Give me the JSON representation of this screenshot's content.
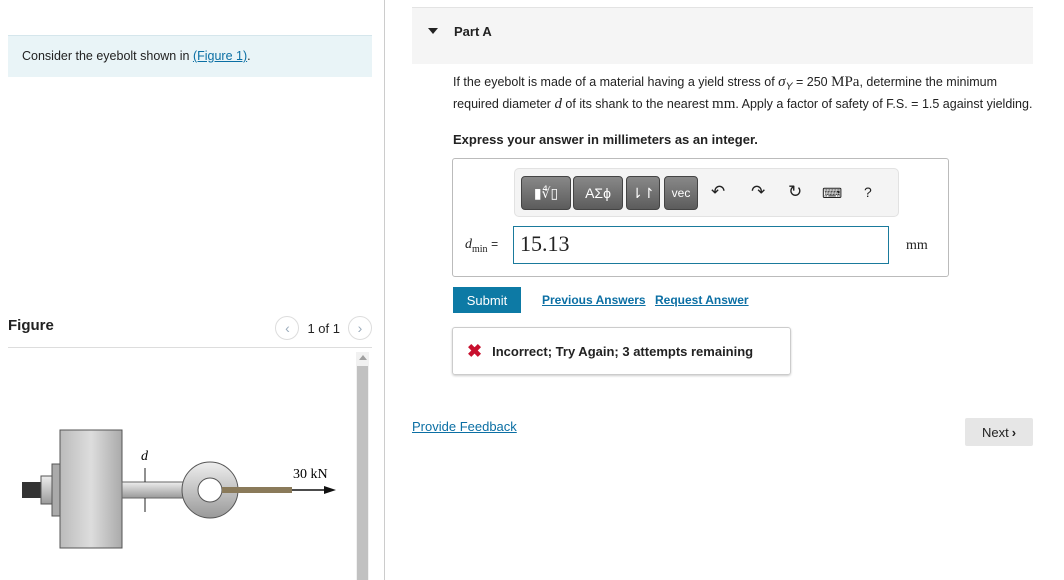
{
  "intro": {
    "text": "Consider the eyebolt shown in ",
    "link": "(Figure 1)",
    "suffix": "."
  },
  "figure": {
    "title": "Figure",
    "pager": "1 of 1",
    "label_d": "d",
    "label_force": "30 kN"
  },
  "part": {
    "title": "Part A"
  },
  "question": {
    "t1": "If the eyebolt is made of a material having a yield stress of ",
    "sigma": "σ",
    "sub": "Y",
    "t2": " = 250 ",
    "mpa": "MPa",
    "t3": ", determine the minimum required diameter ",
    "d": "d",
    "t4": " of its shank to the nearest ",
    "mm": "mm",
    "t5": ". Apply a factor of safety of F.S. = 1.5 against yielding."
  },
  "instruction": "Express your answer in millimeters as an integer.",
  "toolbar": {
    "greek": "ΑΣϕ",
    "arrows": "⇂↾",
    "vec": "vec",
    "help": "?"
  },
  "answer": {
    "var": "d",
    "sub": "min",
    "eq": "=",
    "value": "15.13",
    "unit": "mm"
  },
  "buttons": {
    "submit": "Submit",
    "previous": "Previous Answers",
    "request": "Request Answer",
    "feedback": "Provide Feedback",
    "next": "Next"
  },
  "feedback": {
    "icon": "✖",
    "text": "Incorrect; Try Again; 3 attempts remaining",
    "color": "#c8102e"
  }
}
